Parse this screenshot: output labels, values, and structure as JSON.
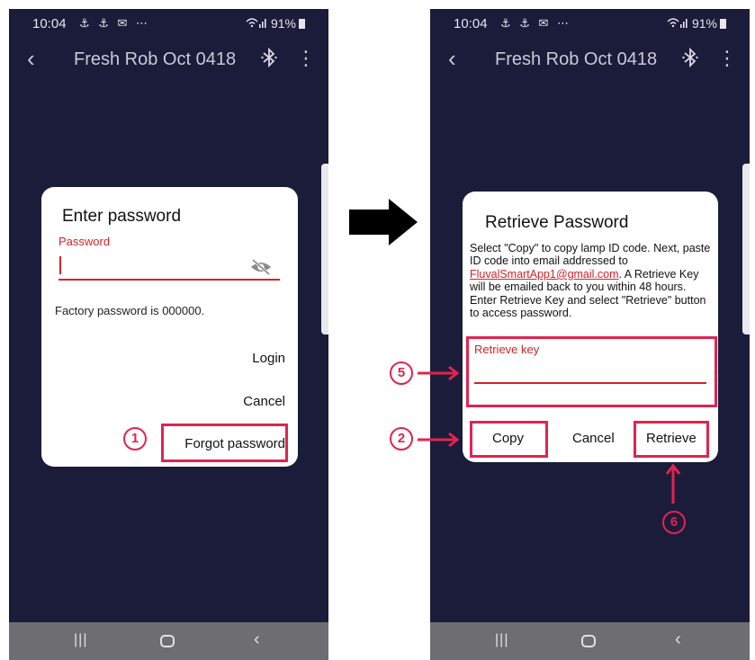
{
  "status_bar": {
    "time": "10:04",
    "notification_icons": "⚓ ⚓ ✉ ⋯",
    "battery": "91%"
  },
  "app_bar": {
    "title": "Fresh Rob Oct 0418"
  },
  "left_dialog": {
    "title": "Enter password",
    "password_label": "Password",
    "factory_note": "Factory password is 000000.",
    "login_label": "Login",
    "cancel_label": "Cancel",
    "forgot_label": "Forgot password"
  },
  "right_dialog": {
    "title": "Retrieve Password",
    "desc_before_link": "Select \"Copy\" to copy lamp ID code. Next, paste ID code into email addressed to ",
    "email_link": "FluvalSmartApp1@gmail.com",
    "desc_after_link": ". A Retrieve Key will be emailed back to you within 48 hours. Enter Retrieve Key and select \"Retrieve\" button to access password.",
    "retrieve_key_label": "Retrieve key",
    "copy_label": "Copy",
    "cancel_label": "Cancel",
    "retrieve_label": "Retrieve"
  },
  "step_markers": {
    "forgot": "1",
    "copy": "2",
    "retrieve_key": "5",
    "retrieve": "6"
  },
  "colors": {
    "screen_bg": "#1b1c3a",
    "accent_red": "#d2232a",
    "highlight": "#e02450",
    "nav_bar": "#6e6e72"
  },
  "icons": {
    "back": "back-arrow-icon",
    "bluetooth": "bluetooth-icon",
    "more": "more-vertical-icon",
    "eye": "eye-off-icon"
  }
}
